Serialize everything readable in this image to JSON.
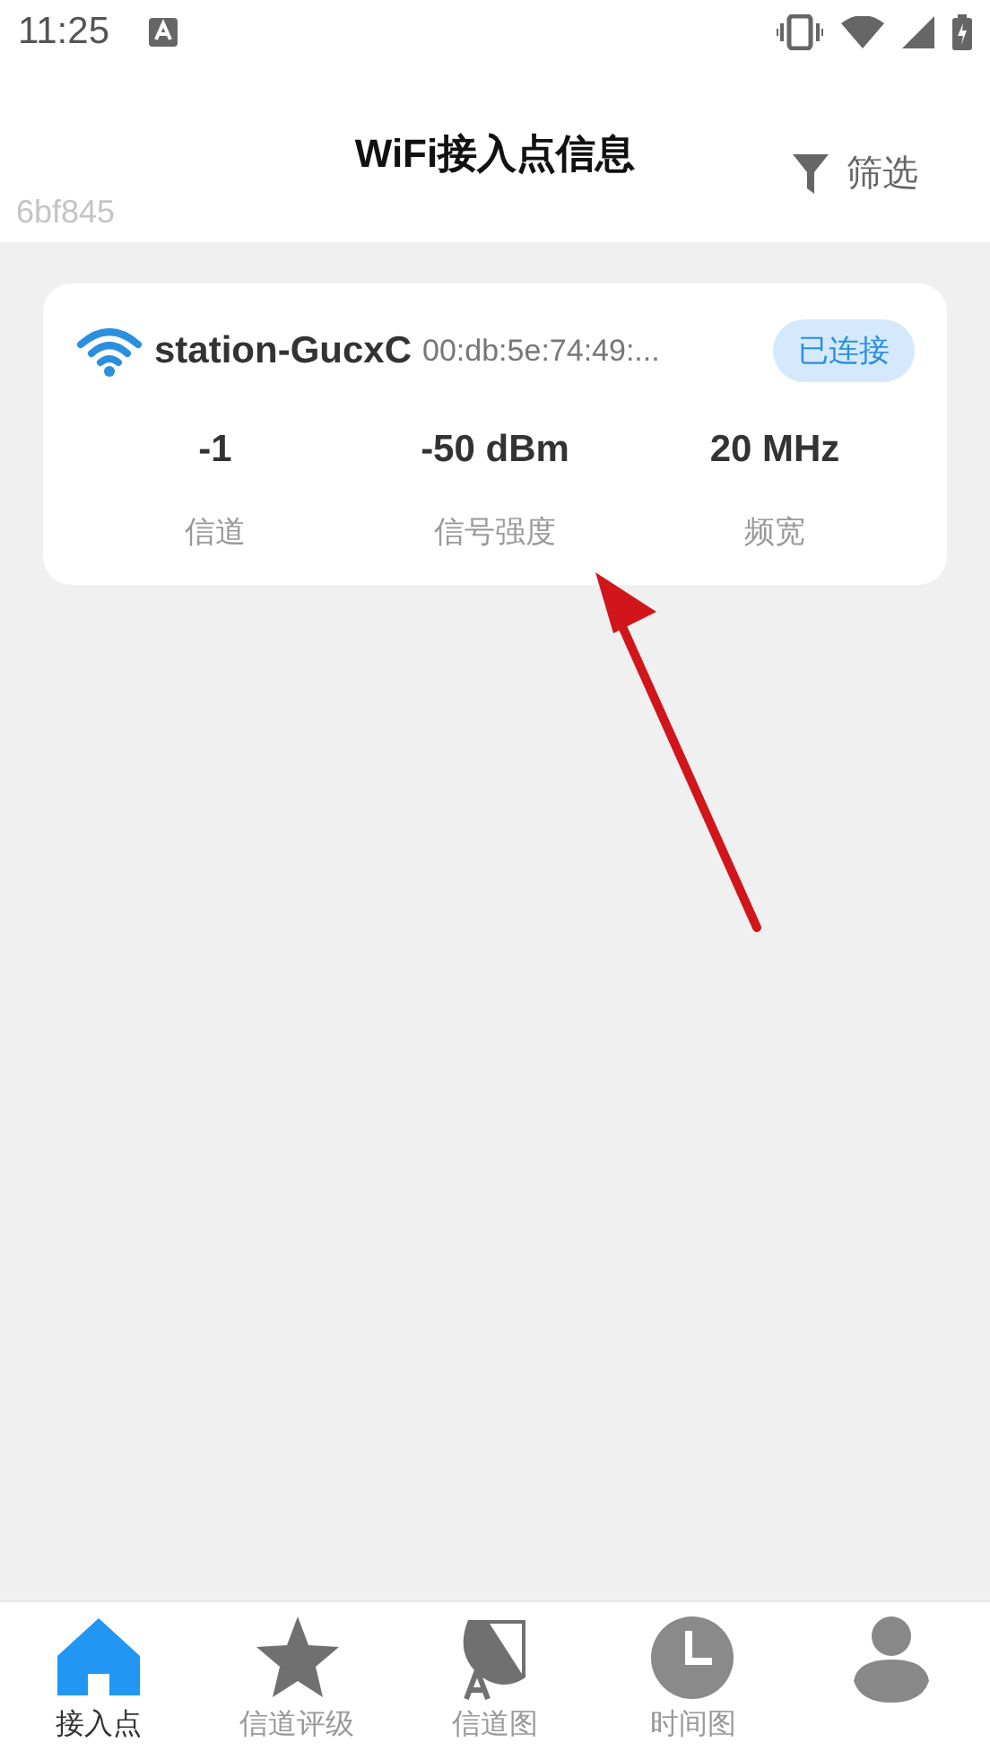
{
  "status_bar": {
    "time": "11:25"
  },
  "header": {
    "title": "WiFi接入点信息",
    "filter": "筛选",
    "build": "6bf845"
  },
  "access_points": [
    {
      "ssid": "station-GucxC",
      "bssid": "00:db:5e:74:49:...",
      "connected": true,
      "status": "已连接",
      "stats": [
        {
          "value": "-1",
          "label": "信道"
        },
        {
          "value": "-50 dBm",
          "label": "信号强度"
        },
        {
          "value": "20 MHz",
          "label": "频宽"
        }
      ]
    }
  ],
  "nav": [
    {
      "kind": "home",
      "label": "接入点",
      "selected": true
    },
    {
      "kind": "star",
      "label": "信道评级",
      "selected": false
    },
    {
      "kind": "dish",
      "label": "信道图",
      "selected": false
    },
    {
      "kind": "clock",
      "label": "时间图",
      "selected": false
    },
    {
      "kind": "person",
      "selected": false
    }
  ]
}
